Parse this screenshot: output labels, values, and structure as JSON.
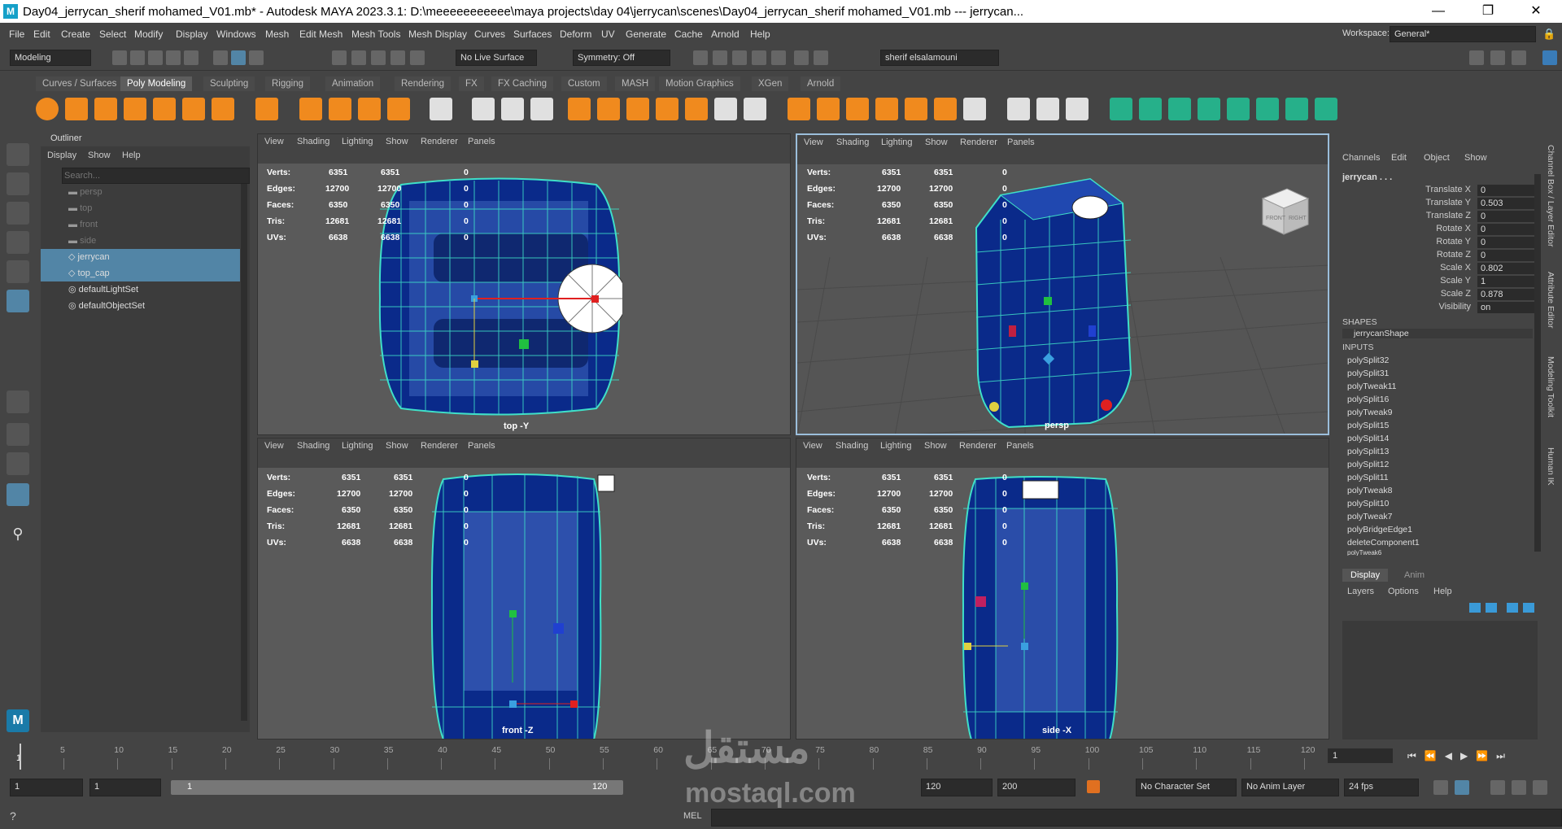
{
  "title_bar": {
    "app_icon": "M",
    "title": "Day04_jerrycan_sherif mohamed_V01.mb* - Autodesk MAYA 2023.3.1: D:\\meeeeeeeeeee\\maya projects\\day 04\\jerrycan\\scenes\\Day04_jerrycan_sherif mohamed_V01.mb   ---   jerrycan...",
    "minimize": "—",
    "maximize": "❐",
    "close": "✕"
  },
  "menu_bar": {
    "items": [
      "File",
      "Edit",
      "Create",
      "Select",
      "Modify",
      "Display",
      "Windows",
      "Mesh",
      "Edit Mesh",
      "Mesh Tools",
      "Mesh Display",
      "Curves",
      "Surfaces",
      "Deform",
      "UV",
      "Generate",
      "Cache",
      "Arnold",
      "Help"
    ],
    "workspace_label": "Workspace:",
    "workspace_value": "General*"
  },
  "status_line": {
    "mode": "Modeling",
    "live_surface": "No Live Surface",
    "symmetry": "Symmetry: Off",
    "user": "sherif elsalamouni"
  },
  "shelf": {
    "tabs": [
      "Curves / Surfaces",
      "Poly Modeling",
      "Sculpting",
      "Rigging",
      "Animation",
      "Rendering",
      "FX",
      "FX Caching",
      "Custom",
      "MASH",
      "Motion Graphics",
      "XGen",
      "Arnold"
    ],
    "active_tab": "Poly Modeling",
    "colors": {
      "orange": "#f08a1e",
      "green": "#26b08a",
      "light": "#e0e0e0"
    }
  },
  "outliner": {
    "title": "Outliner",
    "menu": [
      "Display",
      "Show",
      "Help"
    ],
    "search_placeholder": "Search...",
    "items": [
      {
        "label": "persp",
        "state": "dim"
      },
      {
        "label": "top",
        "state": "dim"
      },
      {
        "label": "front",
        "state": "dim"
      },
      {
        "label": "side",
        "state": "dim"
      },
      {
        "label": "jerrycan",
        "state": "selected"
      },
      {
        "label": "top_cap",
        "state": "selected"
      },
      {
        "label": "defaultLightSet",
        "state": "normal"
      },
      {
        "label": "defaultObjectSet",
        "state": "normal"
      }
    ]
  },
  "viewport_menu": [
    "View",
    "Shading",
    "Lighting",
    "Show",
    "Renderer",
    "Panels"
  ],
  "hud": {
    "rows": [
      {
        "label": "Verts:",
        "a": "6351",
        "b": "6351",
        "c": "0"
      },
      {
        "label": "Edges:",
        "a": "12700",
        "b": "12700",
        "c": "0"
      },
      {
        "label": "Faces:",
        "a": "6350",
        "b": "6350",
        "c": "0"
      },
      {
        "label": "Tris:",
        "a": "12681",
        "b": "12681",
        "c": "0"
      },
      {
        "label": "UVs:",
        "a": "6638",
        "b": "6638",
        "c": "0"
      }
    ]
  },
  "viewports": {
    "top": {
      "camera": "top -Y"
    },
    "persp": {
      "camera": "persp",
      "cube_front": "FRONT",
      "cube_right": "RIGHT"
    },
    "front": {
      "camera": "front -Z"
    },
    "side": {
      "camera": "side -X"
    }
  },
  "model_colors": {
    "body": "#0a2a8a",
    "light": "#4a70c8",
    "wire": "#3fe0c8",
    "dark": "#061a5a"
  },
  "channel_box": {
    "menu": [
      "Channels",
      "Edit",
      "Object",
      "Show"
    ],
    "object": "jerrycan . . .",
    "channels": [
      {
        "name": "Translate X",
        "value": "0"
      },
      {
        "name": "Translate Y",
        "value": "0.503"
      },
      {
        "name": "Translate Z",
        "value": "0"
      },
      {
        "name": "Rotate X",
        "value": "0"
      },
      {
        "name": "Rotate Y",
        "value": "0"
      },
      {
        "name": "Rotate Z",
        "value": "0"
      },
      {
        "name": "Scale X",
        "value": "0.802"
      },
      {
        "name": "Scale Y",
        "value": "1"
      },
      {
        "name": "Scale Z",
        "value": "0.878"
      },
      {
        "name": "Visibility",
        "value": "on"
      }
    ],
    "shapes_header": "SHAPES",
    "shape": "jerrycanShape",
    "inputs_header": "INPUTS",
    "inputs": [
      "polySplit32",
      "polySplit31",
      "polyTweak11",
      "polySplit16",
      "polyTweak9",
      "polySplit15",
      "polySplit14",
      "polySplit13",
      "polySplit12",
      "polySplit11",
      "polyTweak8",
      "polySplit10",
      "polyTweak7",
      "polyBridgeEdge1",
      "deleteComponent1",
      "polyTweak6"
    ]
  },
  "layer_editor": {
    "tabs": [
      "Display",
      "Anim"
    ],
    "active_tab": "Display",
    "menu": [
      "Layers",
      "Options",
      "Help"
    ]
  },
  "side_tabs": [
    "Channel Box / Layer Editor",
    "Attribute Editor",
    "Modeling Toolkit",
    "Human IK"
  ],
  "timeline": {
    "ticks": [
      "5",
      "10",
      "15",
      "20",
      "25",
      "30",
      "35",
      "40",
      "45",
      "50",
      "55",
      "60",
      "65",
      "70",
      "75",
      "80",
      "85",
      "90",
      "95",
      "100",
      "105",
      "110",
      "115",
      "120"
    ],
    "start_marker": "1",
    "current_frame": "1"
  },
  "range": {
    "start": "1",
    "playback_start": "1",
    "slider_start": "1",
    "slider_end": "120",
    "playback_end": "120",
    "end": "200",
    "character_set": "No Character Set",
    "anim_layer": "No Anim Layer",
    "fps": "24 fps"
  },
  "command_line": {
    "label": "MEL"
  },
  "watermark": {
    "arabic": "مستقل",
    "latin": "mostaql.com"
  }
}
